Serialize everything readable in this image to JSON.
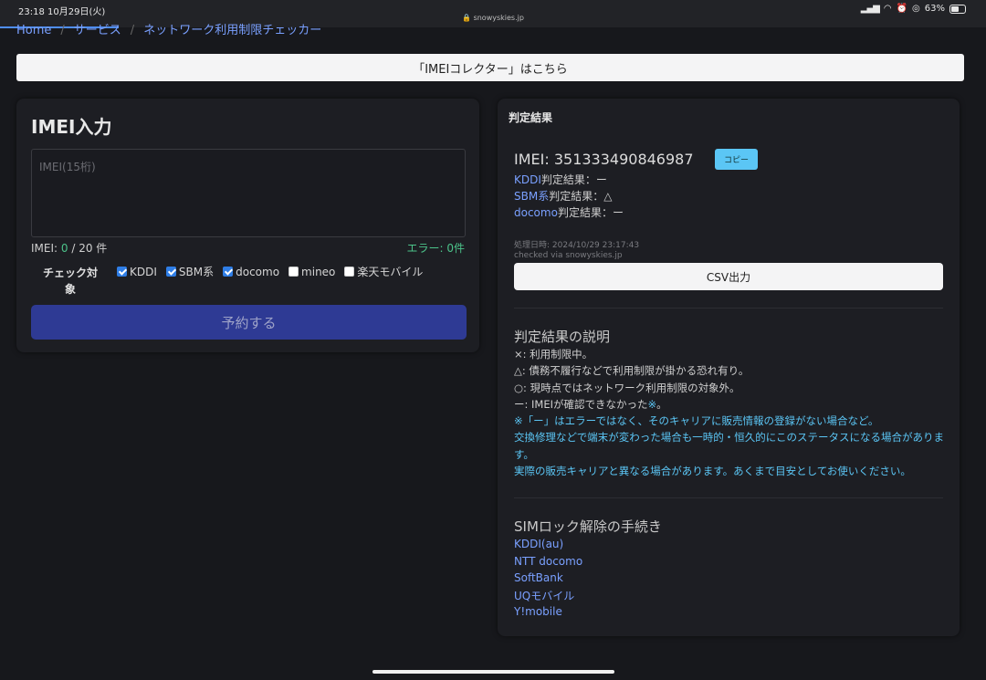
{
  "status_bar": {
    "time_date": "23:18  10月29日(火)",
    "url": "🔒 snowyskies.jp",
    "battery_pct_label": "63%",
    "battery_level": 0.63
  },
  "breadcrumb": [
    "Home",
    "サービス",
    "ネットワーク利用制限チェッカー"
  ],
  "banner": {
    "label": "「IMEIコレクター」はこちら"
  },
  "input_panel": {
    "title": "IMEI入力",
    "textarea_placeholder": "IMEI(15桁)",
    "count_prefix": "IMEI: ",
    "count_value": "0",
    "count_suffix": " / 20 件",
    "error_text": "エラー: 0件",
    "check_label": "チェック対象",
    "carriers": [
      {
        "label": "KDDI",
        "checked": true
      },
      {
        "label": "SBM系",
        "checked": true
      },
      {
        "label": "docomo",
        "checked": true
      },
      {
        "label": "mineo",
        "checked": false
      },
      {
        "label": "楽天モバイル",
        "checked": false
      }
    ],
    "submit_label": "予約する"
  },
  "result_panel": {
    "title": "判定結果",
    "imei_text": "IMEI: 351333490846987",
    "copy_label": "コピー",
    "results": [
      {
        "carrier": "KDDI",
        "label": "判定結果：ー"
      },
      {
        "carrier": "SBM系",
        "label": "判定結果：△"
      },
      {
        "carrier": "docomo",
        "label": "判定結果：ー"
      }
    ],
    "processed_at": "処理日時: 2024/10/29 23:17:43",
    "checked_via": "checked via snowyskies.jp",
    "csv_label": "CSV出力",
    "explanation_title": "判定結果の説明",
    "explanation_lines": [
      "×: 利用制限中。",
      "△: 債務不履行などで利用制限が掛かる恐れ有り。",
      "○: 現時点ではネットワーク利用制限の対象外。",
      "ー: IMEIが確認できなかった"
    ],
    "explanation_mark": "※",
    "explanation_mark_tail": "。",
    "notes": [
      "※「ー」はエラーではなく、そのキャリアに販売情報の登録がない場合など。",
      "交換修理などで端末が変わった場合も一時的・恒久的にこのステータスになる場合があります。",
      "実際の販売キャリアと異なる場合があります。あくまで目安としてお使いください。"
    ],
    "sim_title": "SIMロック解除の手続き",
    "sim_links": [
      "KDDI(au)",
      "NTT docomo",
      "SoftBank",
      "UQモバイル",
      "Y!mobile"
    ]
  },
  "colors": {
    "accent_link": "#7aa0ff",
    "note_cyan": "#5bc6f5",
    "ok_green": "#4cc38a",
    "button_navy": "#2e3a94"
  }
}
